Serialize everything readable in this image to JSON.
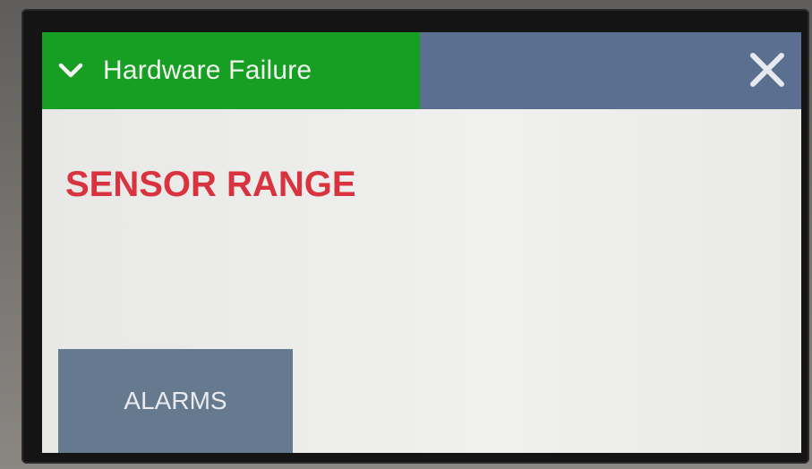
{
  "header": {
    "status_title": "Hardware Failure",
    "status_color": "#169f23",
    "bar_color": "#5b6f90",
    "expand_icon": "chevron-down-icon",
    "close_icon": "close-icon"
  },
  "main": {
    "error_message": "SENSOR RANGE",
    "error_color": "#d8333f"
  },
  "footer": {
    "alarms_label": "ALARMS",
    "alarms_color": "#65798f"
  }
}
